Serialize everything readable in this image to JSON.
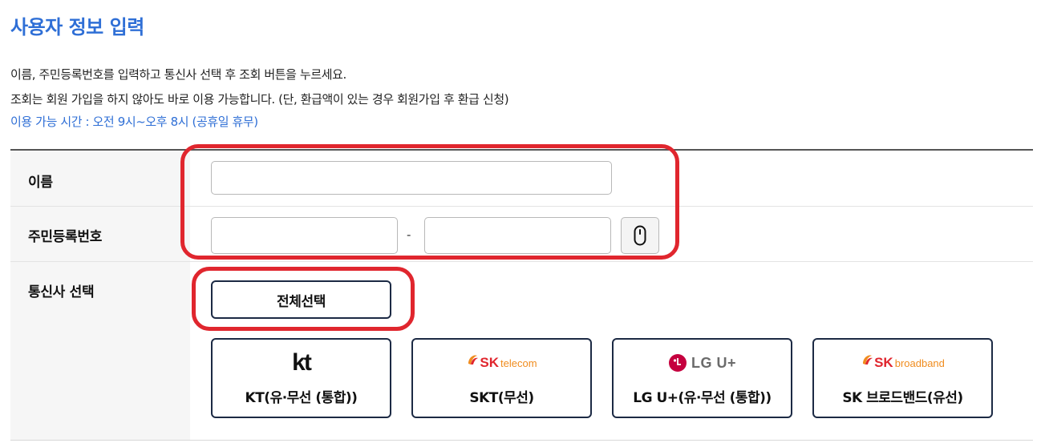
{
  "page": {
    "title": "사용자 정보 입력",
    "description_lines": [
      "이름, 주민등록번호를 입력하고 통신사 선택 후 조회 버튼을 누르세요.",
      "조회는 회원 가입을 하지 않아도 바로 이용 가능합니다. (단, 환급액이 있는 경우 회원가입 후 환급 신청)"
    ],
    "hours_notice": "이용 가능 시간 : 오전 9시~오후 8시 (공휴일 휴무)"
  },
  "form": {
    "name_label": "이름",
    "name_value": "",
    "rrn_label": "주민등록번호",
    "rrn_front_value": "",
    "rrn_back_value": "",
    "rrn_separator": "-",
    "mask_toggle_icon": "mouse-icon",
    "carrier_label": "통신사 선택",
    "select_all_label": "전체선택",
    "carriers": [
      {
        "logo_text": "kt",
        "label": "KT(유·무선 (통합))"
      },
      {
        "logo_text": "SK",
        "logo_sub": "telecom",
        "label": "SKT(무선)"
      },
      {
        "logo_text": "LG U+",
        "label": "LG U+(유·무선 (통합))"
      },
      {
        "logo_text": "SK",
        "logo_sub": "broadband",
        "label": "SK 브로드밴드(유선)"
      }
    ]
  },
  "colors": {
    "accent": "#2f6fd6",
    "highlight": "#e0262e",
    "button_border": "#1c2a44"
  }
}
